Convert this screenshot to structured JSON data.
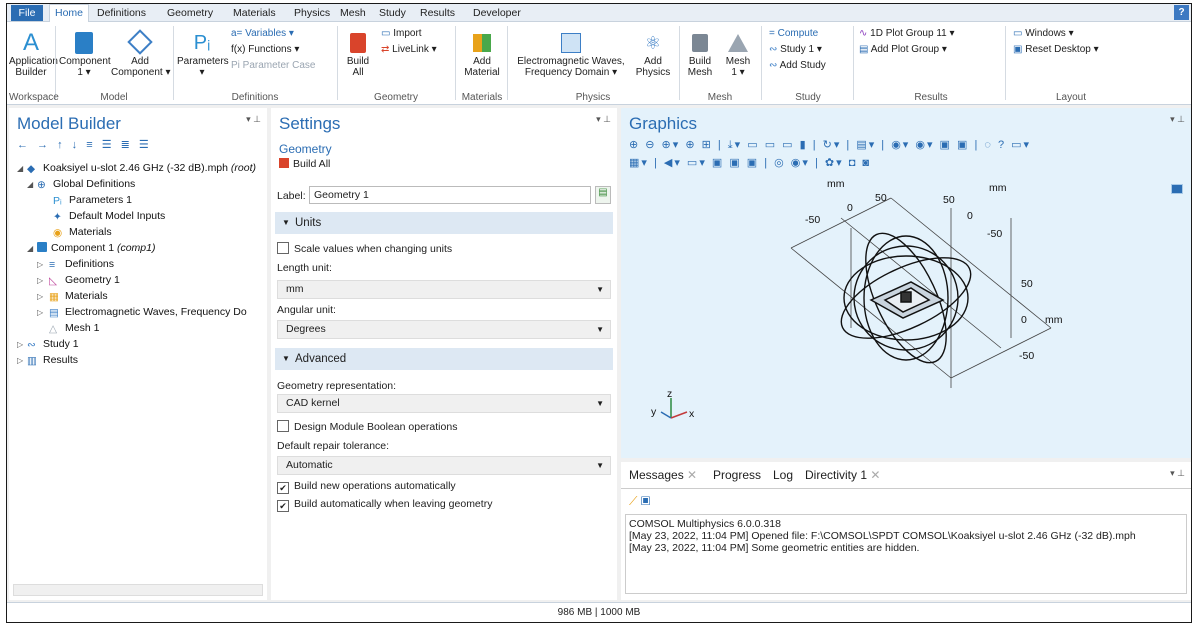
{
  "menu": {
    "file": "File",
    "home": "Home",
    "items": [
      "Definitions",
      "Geometry",
      "Materials",
      "Physics",
      "Mesh",
      "Study",
      "Results",
      "Developer"
    ],
    "help": "?"
  },
  "ribbon": {
    "app_builder": "Application\nBuilder",
    "component": "Component\n1 ▾",
    "add_component": "Add\nComponent ▾",
    "parameters": "Parameters\n▾",
    "variables": "a= Variables ▾",
    "functions": "f(x) Functions ▾",
    "param_case": "Pi Parameter Case",
    "build_all": "Build\nAll",
    "import": "Import",
    "livelink": "LiveLink ▾",
    "add_material": "Add\nMaterial",
    "em_waves": "Electromagnetic Waves,\nFrequency Domain ▾",
    "add_physics": "Add\nPhysics",
    "build_mesh": "Build\nMesh",
    "mesh1": "Mesh\n1 ▾",
    "compute": "= Compute",
    "study1": "Study 1 ▾",
    "add_study": "Add Study",
    "plot_group": "1D Plot Group 11 ▾",
    "add_plot_group": "Add Plot Group ▾",
    "windows": "Windows ▾",
    "reset_desktop": "Reset Desktop ▾",
    "groups": [
      "Workspace",
      "Model",
      "Definitions",
      "Geometry",
      "Materials",
      "Physics",
      "Mesh",
      "Study",
      "Results",
      "Layout"
    ]
  },
  "model_builder": {
    "title": "Model Builder",
    "root": "Koaksiyel u-slot 2.46 GHz (-32 dB).mph",
    "root_suffix": "(root)",
    "global_defs": "Global Definitions",
    "parameters1": "Parameters 1",
    "default_inputs": "Default Model Inputs",
    "materials": "Materials",
    "component": "Component 1",
    "component_suffix": "(comp1)",
    "definitions": "Definitions",
    "geometry1": "Geometry 1",
    "materials2": "Materials",
    "emw": "Electromagnetic Waves, Frequency Do",
    "mesh1": "Mesh 1",
    "study1": "Study 1",
    "results": "Results"
  },
  "settings": {
    "title": "Settings",
    "subtitle": "Geometry",
    "build_all": "Build All",
    "label_text": "Label:",
    "label_value": "Geometry 1",
    "units_section": "Units",
    "scale_values": "Scale values when changing units",
    "length_unit_label": "Length unit:",
    "length_unit": "mm",
    "angular_unit_label": "Angular unit:",
    "angular_unit": "Degrees",
    "advanced_section": "Advanced",
    "geom_rep_label": "Geometry representation:",
    "geom_rep": "CAD kernel",
    "design_module": "Design Module Boolean operations",
    "repair_label": "Default repair tolerance:",
    "repair": "Automatic",
    "build_new": "Build new operations automatically",
    "build_leaving": "Build automatically when leaving geometry"
  },
  "graphics": {
    "title": "Graphics",
    "axis_unit": "mm",
    "tick_50": "50",
    "tick_0": "0",
    "tick_m50": "-50",
    "ax_x": "x",
    "ax_y": "y",
    "ax_z": "z"
  },
  "messages": {
    "tabs": [
      "Messages",
      "Progress",
      "Log",
      "Directivity 1"
    ],
    "lines": [
      "COMSOL Multiphysics 6.0.0.318",
      "[May 23, 2022, 11:04 PM] Opened file: F:\\COMSOL\\SPDT COMSOL\\Koaksiyel u-slot 2.46 GHz (-32 dB).mph",
      "[May 23, 2022, 11:04 PM] Some geometric entities are hidden."
    ]
  },
  "status": {
    "memory": "986 MB | 1000 MB"
  }
}
